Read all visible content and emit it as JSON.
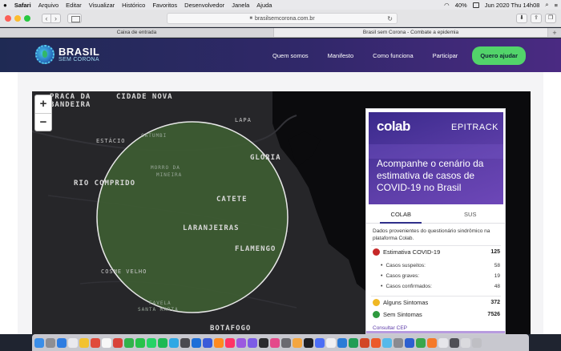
{
  "menubar": {
    "apple": "",
    "app": "Safari",
    "items": [
      "Arquivo",
      "Editar",
      "Visualizar",
      "Histórico",
      "Favoritos",
      "Desenvolvedor",
      "Janela",
      "Ajuda"
    ],
    "battery": "40%",
    "datetime": "Jun 2020 Thu 14h08"
  },
  "toolbar": {
    "url": "brasilsemcorona.com.br",
    "back": "‹",
    "forward": "›"
  },
  "tabs": [
    {
      "label": "Caixa de entrada",
      "active": false
    },
    {
      "label": "Brasil sem Corona - Combate a epidemia",
      "active": true
    }
  ],
  "site": {
    "logo_big": "BRASIL",
    "logo_small": "SEM CORONA",
    "nav": [
      "Quem somos",
      "Manifesto",
      "Como funciona",
      "Participar"
    ],
    "cta": "Quero ajudar"
  },
  "map": {
    "zoom_in": "+",
    "zoom_out": "−",
    "labels": {
      "praca": "PRACA DA",
      "bandeira": "BANDEIRA",
      "cidade_nova": "CIDADE NOVA",
      "lapa": "LAPA",
      "estacio": "ESTÁCIO",
      "catumbi": "CATUMBI",
      "gloria": "GLÓRIA",
      "rio_comprido": "RIO COMPRIDO",
      "morro_mineira_1": "MORRO DA",
      "morro_mineira_2": "MINEIRA",
      "catete": "CATETE",
      "laranjeiras": "LARANJEIRAS",
      "flamengo": "FLAMENGO",
      "cosme_velho": "COSME VELHO",
      "santa_marta_1": "FAVELA",
      "santa_marta_2": "SANTA MARTA",
      "botafogo": "BOTAFOGO"
    }
  },
  "panel": {
    "brand_left": "colab",
    "brand_right": "EPITRACK",
    "heading": "Acompanhe o cenário da estimativa de casos de COVID-19 no Brasil",
    "tabs": [
      "COLAB",
      "SUS"
    ],
    "active_tab": "COLAB",
    "description": "Dados provenientes do questionário sindrômico na plataforma Colab.",
    "estimativa": {
      "label": "Estimativa COVID-19",
      "value": "125",
      "color": "#c62828"
    },
    "subitems": [
      {
        "label": "Casos suspeitos:",
        "value": "58"
      },
      {
        "label": "Casos graves:",
        "value": "19"
      },
      {
        "label": "Casos confirmados:",
        "value": "48"
      }
    ],
    "alguns": {
      "label": "Alguns Sintomas",
      "value": "372",
      "color": "#f0b824"
    },
    "sem": {
      "label": "Sem Sintomas",
      "value": "7526",
      "color": "#2e9a3e"
    },
    "cep": "Consultar CEP"
  },
  "colors": {
    "header_start": "#1f2a54",
    "header_end": "#4a2a82",
    "cta": "#52d46a",
    "circle_fill": "#3d5c32",
    "map_bg": "#262629"
  }
}
